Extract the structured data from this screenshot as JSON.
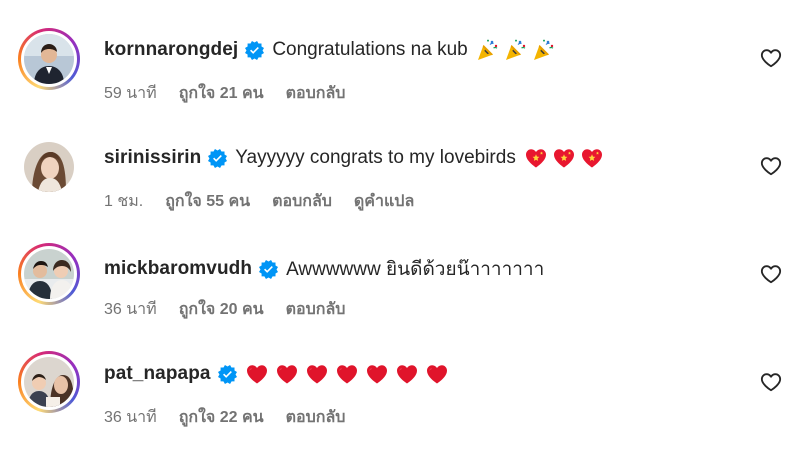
{
  "comments": [
    {
      "username": "kornnarongdej",
      "verified": true,
      "text": "Congratulations na kub",
      "emojis": [
        "party-popper",
        "party-popper",
        "party-popper"
      ],
      "time": "59 นาที",
      "likes": "ถูกใจ 21 คน",
      "reply": "ตอบกลับ",
      "translate": ""
    },
    {
      "username": "sirinissirin",
      "verified": true,
      "text": "Yayyyyy congrats to my lovebirds",
      "emojis": [
        "sparkling-heart",
        "sparkling-heart",
        "sparkling-heart"
      ],
      "time": "1 ชม.",
      "likes": "ถูกใจ 55 คน",
      "reply": "ตอบกลับ",
      "translate": "ดูคำแปล"
    },
    {
      "username": "mickbaromvudh",
      "verified": true,
      "text": "Awwwwww ยินดีด้วยน๊าาาาาาา",
      "emojis": [],
      "time": "36 นาที",
      "likes": "ถูกใจ 20 คน",
      "reply": "ตอบกลับ",
      "translate": ""
    },
    {
      "username": "pat_napapa",
      "verified": true,
      "text": "",
      "emojis": [
        "red-heart",
        "red-heart",
        "red-heart",
        "red-heart",
        "red-heart",
        "red-heart",
        "red-heart"
      ],
      "time": "36 นาที",
      "likes": "ถูกใจ 22 คน",
      "reply": "ตอบกลับ",
      "translate": ""
    }
  ],
  "colors": {
    "text": "#262626",
    "meta": "#737373",
    "verified": "#0095f6",
    "heart": "#ed4956"
  }
}
